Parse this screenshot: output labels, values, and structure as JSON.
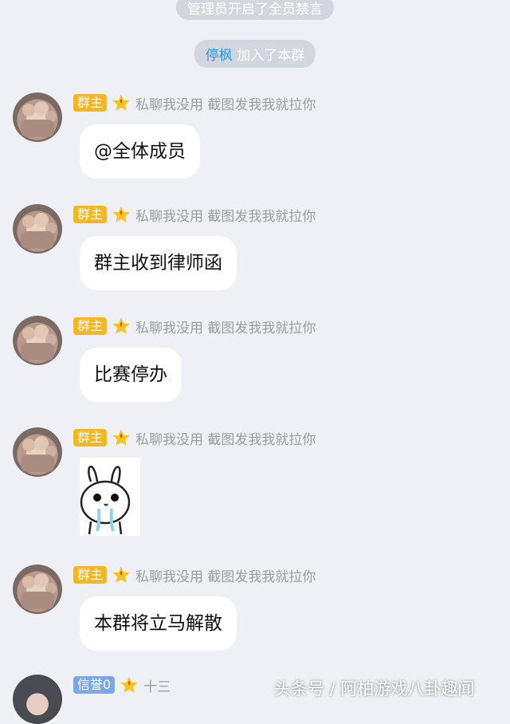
{
  "system_messages": {
    "mute_notice": "管理员开启了全员禁言",
    "join_user": "停枫",
    "join_text": "加入了本群"
  },
  "messages": [
    {
      "badge": "群主",
      "nickname": "私聊我没用 截图发我我就拉你",
      "text": "@全体成员"
    },
    {
      "badge": "群主",
      "nickname": "私聊我没用 截图发我我就拉你",
      "text": "群主收到律师函"
    },
    {
      "badge": "群主",
      "nickname": "私聊我没用 截图发我我就拉你",
      "text": "比赛停办"
    },
    {
      "badge": "群主",
      "nickname": "私聊我没用 截图发我我就拉你",
      "sticker": "rabbit-sticker"
    },
    {
      "badge": "群主",
      "nickname": "私聊我没用 截图发我我就拉你",
      "text": "本群将立马解散"
    },
    {
      "badge": "信誉0",
      "nickname": "十三"
    }
  ],
  "watermark": "头条号 / 阿柏游戏八卦趣闻",
  "colors": {
    "background": "#eef0f6",
    "owner_badge": "#f6b71c",
    "credit_badge": "#7aa8e6",
    "link_name": "#2d95d9"
  }
}
